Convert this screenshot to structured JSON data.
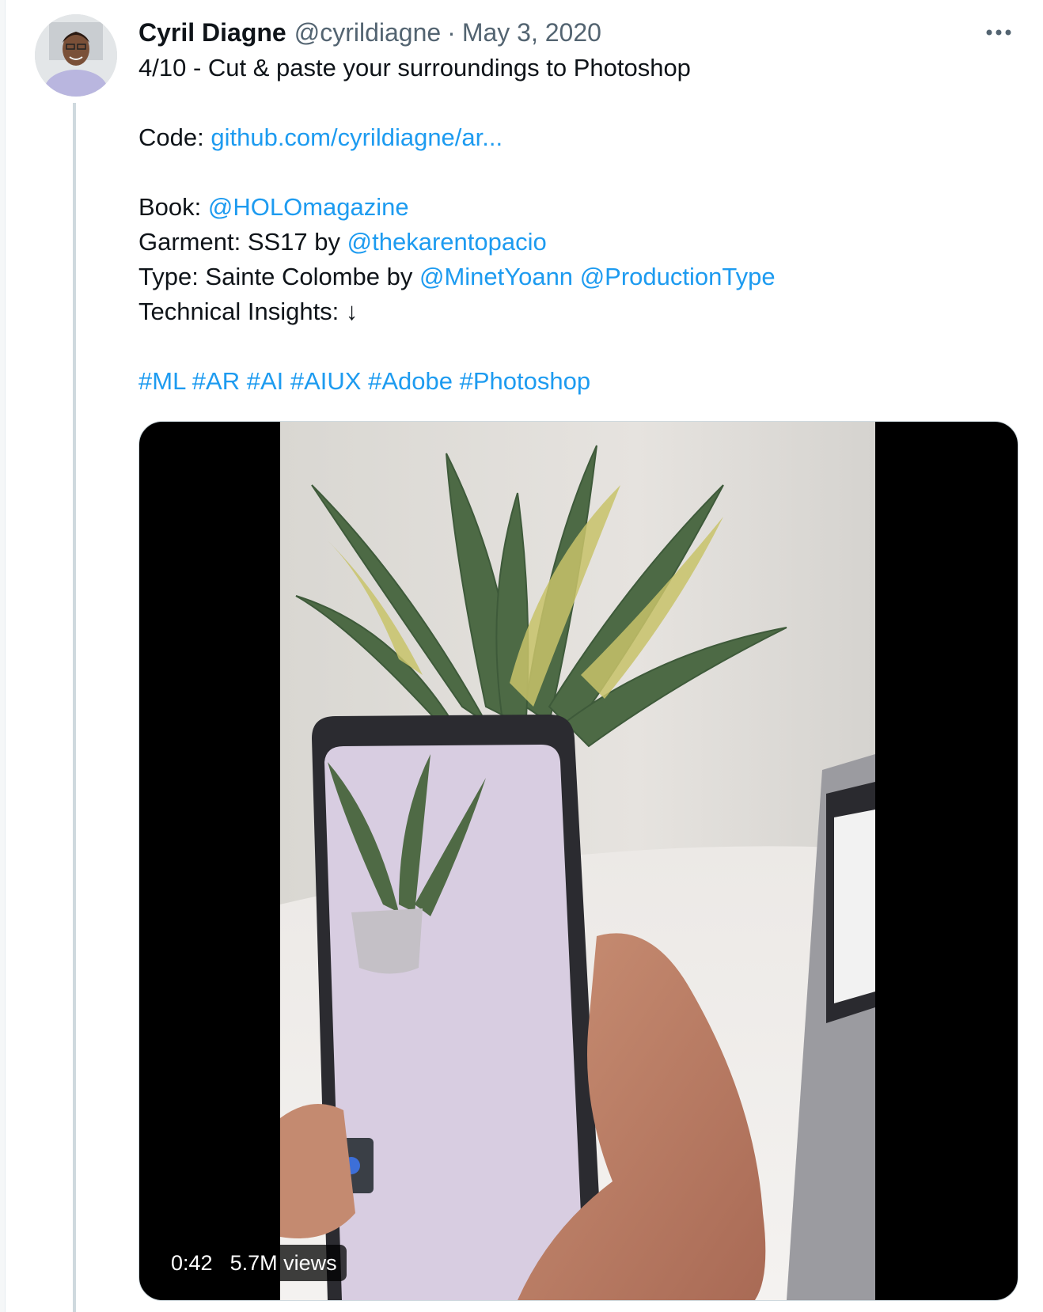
{
  "tweet": {
    "author_name": "Cyril Diagne",
    "author_handle": "@cyrildiagne",
    "separator": "·",
    "date": "May 3, 2020",
    "more_label": "•••",
    "title": "4/10 - Cut & paste your surroundings to Photoshop",
    "code_label": "Code:",
    "code_link": "github.com/cyrildiagne/ar...",
    "book_label": "Book:",
    "book_mention": "@HOLOmagazine",
    "garment_label": "Garment: SS17 by",
    "garment_mention": "@thekarentopacio",
    "type_label": "Type: Sainte Colombe by",
    "type_mention_1": "@MinetYoann",
    "type_mention_2": "@ProductionType",
    "insights_label": "Technical Insights: ↓",
    "hashtags": [
      "#ML",
      "#AR",
      "#AI",
      "#AIUX",
      "#Adobe",
      "#Photoshop"
    ]
  },
  "video": {
    "duration": "0:42",
    "views": "5.7M views"
  },
  "colors": {
    "link": "#1d9bf0",
    "text": "#0f1419",
    "muted": "#536471"
  }
}
